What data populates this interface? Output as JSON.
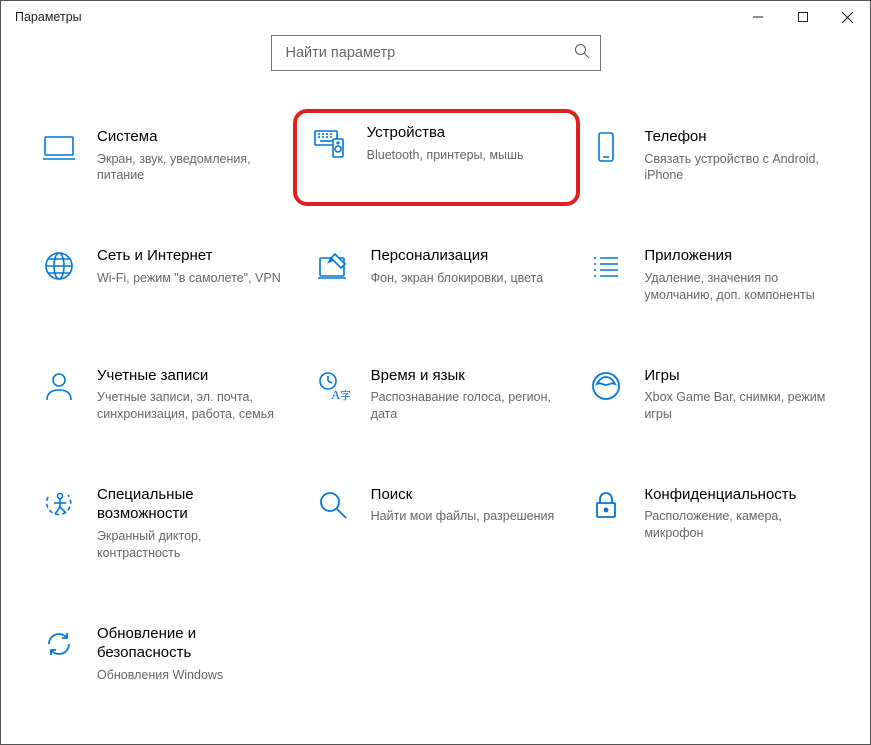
{
  "window": {
    "title": "Параметры"
  },
  "search": {
    "placeholder": "Найти параметр"
  },
  "tiles": {
    "system": {
      "title": "Система",
      "desc": "Экран, звук, уведомления, питание"
    },
    "devices": {
      "title": "Устройства",
      "desc": "Bluetooth, принтеры, мышь"
    },
    "phone": {
      "title": "Телефон",
      "desc": "Связать устройство с Android, iPhone"
    },
    "network": {
      "title": "Сеть и Интернет",
      "desc": "Wi-Fi, режим \"в самолете\", VPN"
    },
    "personalization": {
      "title": "Персонализация",
      "desc": "Фон, экран блокировки, цвета"
    },
    "apps": {
      "title": "Приложения",
      "desc": "Удаление, значения по умолчанию, доп. компоненты"
    },
    "accounts": {
      "title": "Учетные записи",
      "desc": "Учетные записи, эл. почта, синхронизация, работа, семья"
    },
    "time": {
      "title": "Время и язык",
      "desc": "Распознавание голоса, регион, дата"
    },
    "gaming": {
      "title": "Игры",
      "desc": "Xbox Game Bar, снимки, режим игры"
    },
    "access": {
      "title": "Специальные возможности",
      "desc": "Экранный диктор, контрастность"
    },
    "search_tile": {
      "title": "Поиск",
      "desc": "Найти мои файлы, разрешения"
    },
    "privacy": {
      "title": "Конфиденциальность",
      "desc": "Расположение, камера, микрофон"
    },
    "update": {
      "title": "Обновление и безопасность",
      "desc": "Обновления Windows"
    }
  }
}
